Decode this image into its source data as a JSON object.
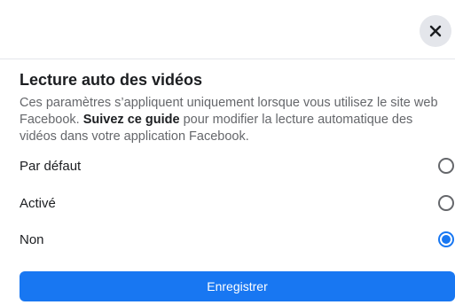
{
  "dialog": {
    "close_icon": "close-icon",
    "title": "Lecture auto des vidéos",
    "description_before": "Ces paramètres s’appliquent uniquement lorsque vous utilisez le site web Facebook. ",
    "guide_link": "Suivez ce guide",
    "description_after": " pour modifier la lecture automatique des vidéos dans votre application Facebook.",
    "options": [
      {
        "label": "Par défaut",
        "selected": false
      },
      {
        "label": "Activé",
        "selected": false
      },
      {
        "label": "Non",
        "selected": true
      }
    ],
    "save_label": "Enregistrer"
  },
  "colors": {
    "accent": "#1877f2",
    "close_bg": "#e4e6eb",
    "text_primary": "#1c1e21",
    "text_secondary": "#65676b"
  }
}
